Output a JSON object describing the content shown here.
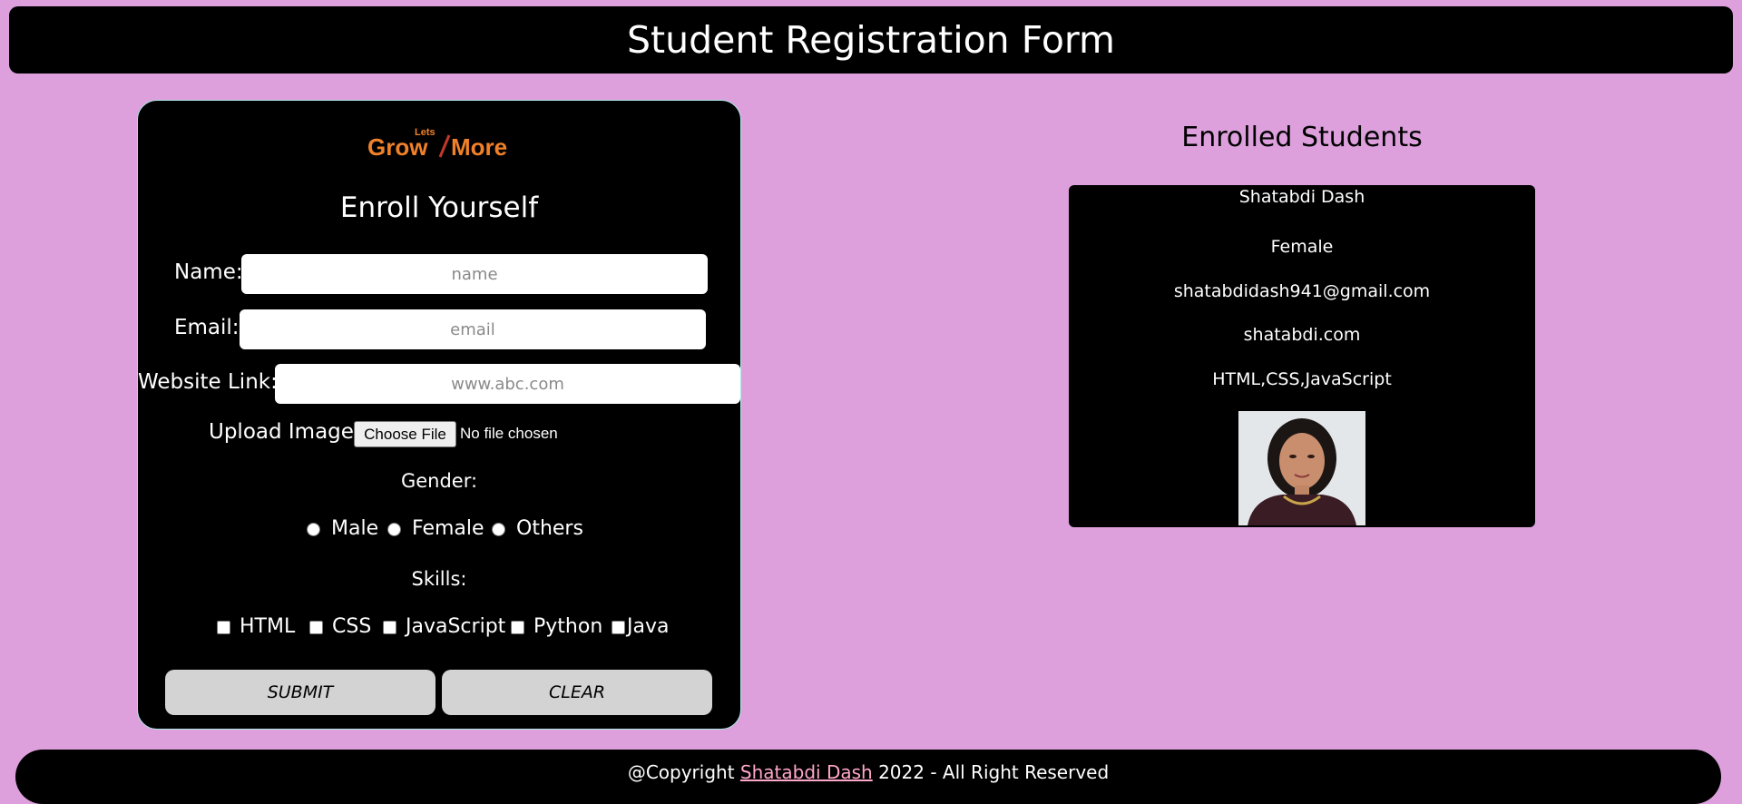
{
  "header": {
    "title": "Student Registration Form"
  },
  "form": {
    "logo": {
      "small": "Lets",
      "main_left": "Grow",
      "main_right": "More"
    },
    "title": "Enroll Yourself",
    "name_label": "Name:",
    "name_placeholder": "name",
    "email_label": "Email:",
    "email_placeholder": "email",
    "website_label": "Website Link:",
    "website_placeholder": "www.abc.com",
    "upload_label": "Upload Image:",
    "file_button": "Choose File",
    "file_status": "No file chosen",
    "gender_label": "Gender:",
    "gender_options": [
      "Male",
      "Female",
      "Others"
    ],
    "skills_label": "Skills:",
    "skill_options": [
      "HTML",
      "CSS",
      "JavaScript",
      "Python",
      "Java"
    ],
    "submit_label": "SUBMIT",
    "clear_label": "CLEAR"
  },
  "enrolled": {
    "title": "Enrolled Students",
    "student": {
      "name": "Shatabdi Dash",
      "gender": "Female",
      "email": "shatabdidash941@gmail.com",
      "website": "shatabdi.com",
      "skills": "HTML,CSS,JavaScript"
    }
  },
  "footer": {
    "prefix": "@Copyright",
    "author": "Shatabdi Dash",
    "suffix": "2022 - All Right Reserved"
  },
  "colors": {
    "background": "#dda0dd",
    "panel": "#000000",
    "logo_orange": "#f0812a",
    "footer_link": "#ffa7c8",
    "button": "#d3d3d3"
  }
}
